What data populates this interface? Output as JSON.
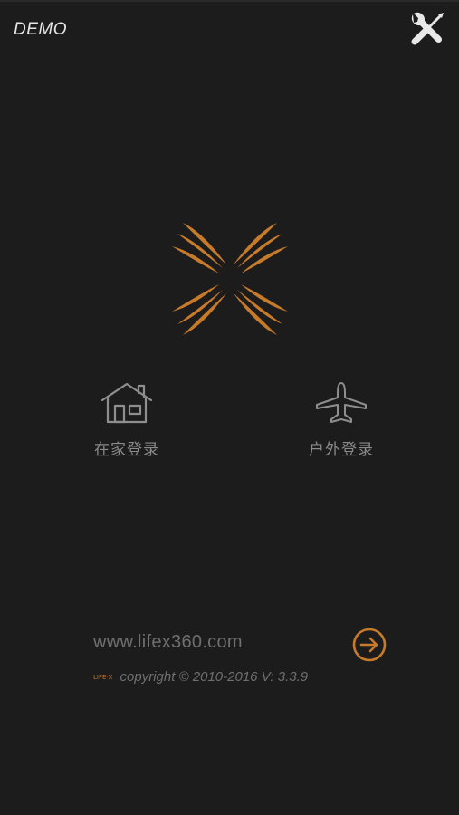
{
  "header": {
    "mode_label": "DEMO",
    "settings_icon": "tools-icon"
  },
  "logo": {
    "icon": "lifex-x-logo-icon",
    "color": "#c77a2a"
  },
  "login_options": [
    {
      "label": "在家登录",
      "icon": "house-icon"
    },
    {
      "label": "户外登录",
      "icon": "airplane-icon"
    }
  ],
  "footer": {
    "website": "www.lifex360.com",
    "go_icon": "arrow-right-circle-icon",
    "brand_mark": "LIFE·X",
    "copyright": "copyright © 2010-2016  V: 3.3.9"
  },
  "colors": {
    "background": "#1d1c1d",
    "accent": "#c77a2a",
    "muted_text": "#8a8a8a",
    "header_text": "#e6e6e6"
  }
}
